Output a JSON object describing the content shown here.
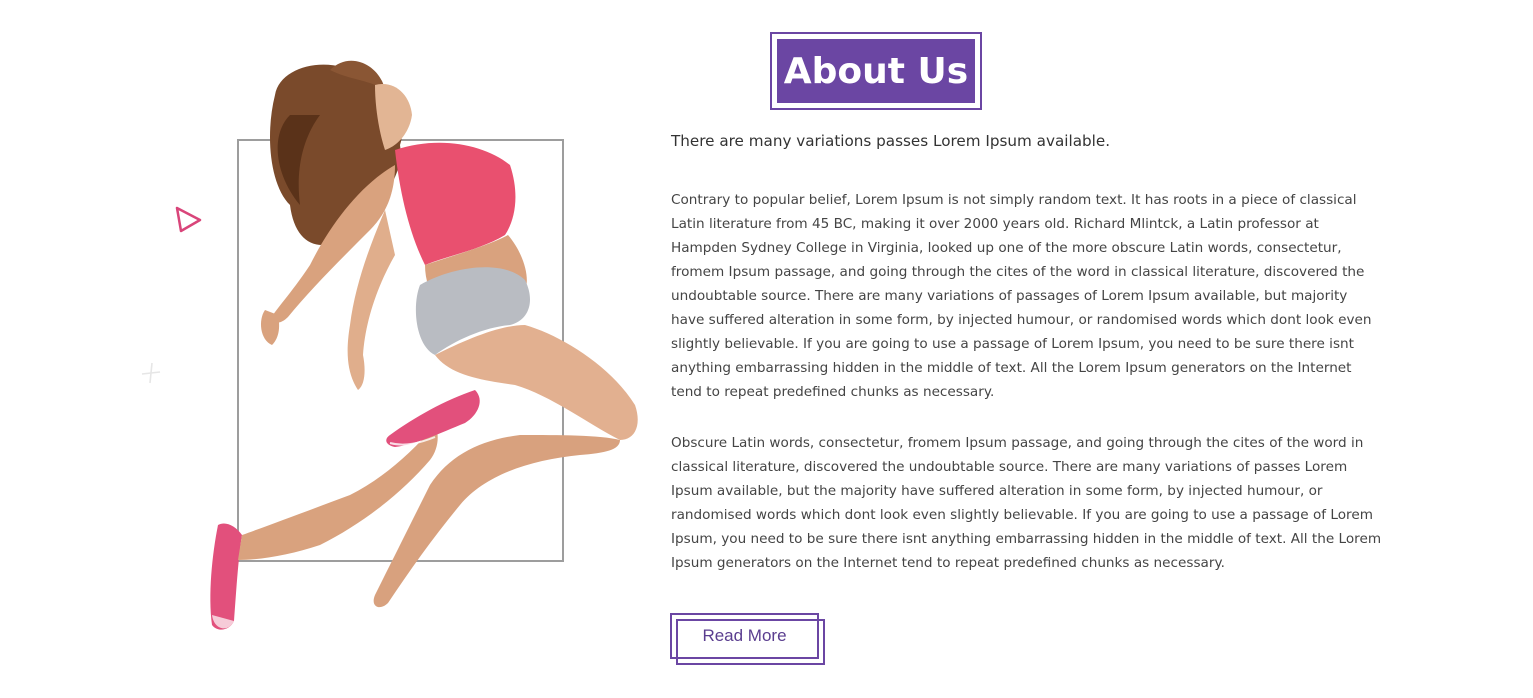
{
  "about": {
    "heading": "About Us",
    "subtitle": "There are many variations passes Lorem Ipsum available.",
    "paragraph_1": "Contrary to popular belief, Lorem Ipsum is not simply random text. It has roots in a piece of classical Latin literature from 45 BC, making it over 2000 years old. Richard Mlintck, a Latin professor at Hampden Sydney College in Virginia, looked up one of the more obscure Latin words, consectetur, fromem Ipsum passage, and going through the cites of the word in classical literature, discovered the undoubtable source. There are many variations of passages of Lorem Ipsum available, but majority have suffered alteration in some form, by injected humour, or randomised words which dont look even slightly believable. If you are going to use a passage of Lorem Ipsum, you need to be sure there isnt anything embarrassing hidden in the middle of text. All the Lorem Ipsum generators on the Internet tend to repeat predefined chunks as necessary.",
    "paragraph_2": "Obscure Latin words, consectetur, fromem Ipsum passage, and going through the cites of the word in classical literature, discovered the undoubtable source. There are many variations of passes Lorem Ipsum available, but the majority have suffered alteration in some form, by injected humour, or randomised words which dont look even slightly believable. If you are going to use a passage of Lorem Ipsum, you need to be sure there isnt anything embarrassing hidden in the middle of text. All the Lorem Ipsum generators on the Internet tend to repeat predefined chunks as necessary.",
    "read_more_label": "Read More"
  },
  "illustration": {
    "image": "jumping-dancer-photo",
    "icons": [
      "triangle-outline-icon",
      "plus-icon"
    ]
  },
  "colors": {
    "accent": "#6b46a3",
    "pink": "#d9457a",
    "frame": "#9d9d9d",
    "text": "#444444"
  }
}
